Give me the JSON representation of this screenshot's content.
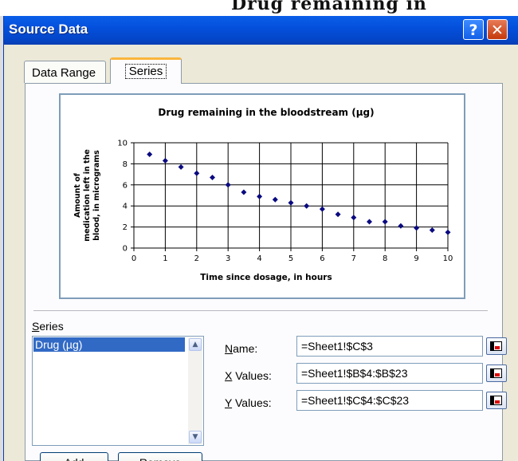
{
  "dialog": {
    "title": "Source Data",
    "help_glyph": "?",
    "close_glyph": "✕"
  },
  "tabs": [
    {
      "label": "Data Range"
    },
    {
      "label": "Series"
    }
  ],
  "chart_data": {
    "type": "scatter",
    "title": "Drug remaining in the bloodstream (µg)",
    "xlabel": "Time since dosage, in hours",
    "ylabel_lines": [
      "Amount of",
      "medication left in the",
      "blood, in micrograms"
    ],
    "xlim": [
      0,
      10
    ],
    "ylim": [
      0,
      10
    ],
    "xticks": [
      "0",
      "1",
      "2",
      "3",
      "4",
      "5",
      "6",
      "7",
      "8",
      "9",
      "10"
    ],
    "yticks": [
      "0",
      "2",
      "4",
      "6",
      "8",
      "10"
    ],
    "grid": true,
    "marker_color": "#0a0a80",
    "series": [
      {
        "name": "Drug (µg)",
        "x": [
          0.5,
          1,
          1.5,
          2,
          2.5,
          3,
          3.5,
          4,
          4.5,
          5,
          5.5,
          6,
          6.5,
          7,
          7.5,
          8,
          8.5,
          9,
          9.5,
          10
        ],
        "y": [
          8.9,
          8.3,
          7.7,
          7.1,
          6.7,
          6.0,
          5.3,
          4.9,
          4.6,
          4.3,
          4.0,
          3.7,
          3.2,
          2.9,
          2.5,
          2.5,
          2.1,
          1.9,
          1.7,
          1.5
        ]
      }
    ]
  },
  "series_section": {
    "label": "Series",
    "items": [
      "Drug (µg)"
    ],
    "add_label": "Add",
    "remove_label": "Remove"
  },
  "fields": {
    "name_label": "Name:",
    "name_value": "=Sheet1!$C$3",
    "x_label": "X Values:",
    "x_value": "=Sheet1!$B$4:$B$23",
    "y_label": "Y Values:",
    "y_value": "=Sheet1!$C$4:$C$23"
  },
  "background": {
    "cut_text": "Drug remaining in"
  }
}
